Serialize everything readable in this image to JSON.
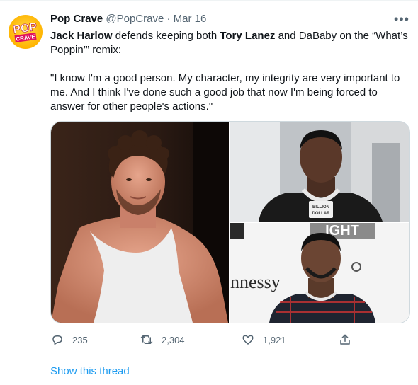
{
  "account": {
    "display_name": "Pop Crave",
    "handle": "@PopCrave",
    "separator": "·",
    "date": "Mar 16",
    "avatar_text_top": "POP",
    "avatar_text_bottom": "CRAVE"
  },
  "tweet": {
    "subject": "Jack Harlow",
    "text_1": " defends keeping both ",
    "person_2": "Tory Lanez",
    "text_2": " and DaBaby on the “What’s Poppin’” remix:",
    "quote": "\"I know I'm a good person. My character, my integrity are very important to me. And I think I've done such a good job that now I'm being forced to answer for other people's actions.\""
  },
  "media": {
    "dababy_chain_text_1": "BILLION",
    "dababy_chain_text_2": "DOLLAR",
    "backdrop_text_top": "IGHT",
    "backdrop_text_left": "nnessy"
  },
  "actions": {
    "replies": "235",
    "retweets": "2,304",
    "likes": "1,921"
  },
  "more_label": "•••",
  "show_thread": "Show this thread",
  "colors": {
    "link": "#1d9bf0",
    "secondary": "#536471",
    "avatar": "#ffb400"
  }
}
